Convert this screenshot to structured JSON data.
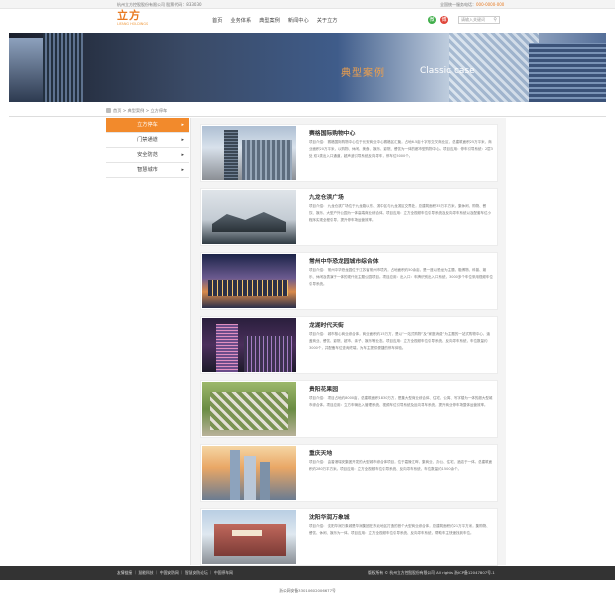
{
  "topbar": {
    "left": "杭州立方控股股份有限公司 股票代码：833030",
    "hotline_label": "全国统一服务电话：",
    "hotline": "000-0000-000"
  },
  "logo": {
    "mark": "立方",
    "sub": "LIFANG HOLDINGS"
  },
  "nav": {
    "items": [
      "首页",
      "业务体系",
      "典型案例",
      "新闻中心",
      "关于立方"
    ]
  },
  "header_icons": {
    "weixin": "微",
    "weibo": "博",
    "search_placeholder": "请输入关键词"
  },
  "banner": {
    "title_cn": "典型案例",
    "title_en": "Classic case"
  },
  "breadcrumb": "首页 > 典型案例 > 立方停车",
  "sidebar": {
    "items": [
      "立方停车",
      "门禁通道",
      "安全防范",
      "智慧城市"
    ],
    "active": 0
  },
  "cases": [
    {
      "title": "赛格国际购物中心",
      "desc": "项目介绍： 赛格国际购物中心位于长安商业中心赛格区汇聚，占地6.5亩十字形交叉商业区，总建筑面积25万平米，商业面积20万平米，以购物、休闲、美食、娱乐、影院、餐饮为一体的都市型购物中心。项目应用：停车引导系统：2层3处 双1类出入口通道，超声波引导系统反向寻车，停车位5000个。"
    },
    {
      "title": "九龙仓滨广场",
      "desc": "项目介绍： 九龙仓滨广场位于九龙路以东、滨中区与九龙滨区交界处，总建筑面积35万平方米，集休闲、购物、餐饮、娱乐、大型户外公园为一体高端商业综合体。项目应用：立方全视频车位引导系统及反向寻车系统以及配套车位小程序实现全程引导，提升停车场运营效率。"
    },
    {
      "title": "常州中华恐龙园城市综合体",
      "desc": "项目介绍： 常州中华恐龙园位于江苏省常州市境内，占地面积约50余亩，是一座以恐龙为主题，融博物、科普、娱乐、休闲及表演于一体的现代化主题公园项目。项目应用：出入口：车牌识别出入口系统，3000多个车位采用视频车位引导系统。"
    },
    {
      "title": "龙湖时代天街",
      "desc": "项目介绍： 城市核心商业综合体，商业面积约15万方，是以“一站式购物”及“家庭消费”为主题的一站式购物中心，涵盖商业、餐饮、影院、超市、亲子、娱乐等业态。项目应用：立方全视频车位引导系统、反向寻车系统，车位数量约3000个，并配备车位查询终端，为车主提供便捷的停车体验。"
    },
    {
      "title": "贵阳花果园",
      "desc": "项目介绍： 项目占地约8000亩，总建筑面积1830万方，是集大型商业综合体、住宅、公寓、写字楼为一体的超大型城市综合体。项目应用：立方车辆出入管理系统、视频车位引导系统及反向寻车系统，提升商业停车场整体运营效率。"
    },
    {
      "title": "重庆天地",
      "desc": "项目介绍： 由香港瑞安集团开发的大型城市综合体项目，位于嘉陵江畔，集商业、办公、住宅、酒店于一体。总建筑面积约280万平方米。项目应用：立方全视频车位引导系统、反向寻车系统，车位数量约1500余个。"
    },
    {
      "title": "沈阳华润万象城",
      "desc": "项目介绍： 沈阳华润万象城是华润集团在东北地区打造的首个大型商业综合体，总建筑面积约21万平方米，集购物、餐饮、休闲、娱乐为一体。项目应用：立方全视频车位引导系统、反向寻车系统，帮助车主快速找到车位。"
    }
  ],
  "footer": {
    "left": "友情链接 ｜ 慧能科技 ｜ 中国安防网 ｜ 智慧安防论坛 ｜ 中国停车网",
    "right": "版权所有 © 杭州立方控股股份有限公司 All rights 浙ICP备12047807号-1"
  },
  "bottom": "浙公网安备33010602006677号"
}
